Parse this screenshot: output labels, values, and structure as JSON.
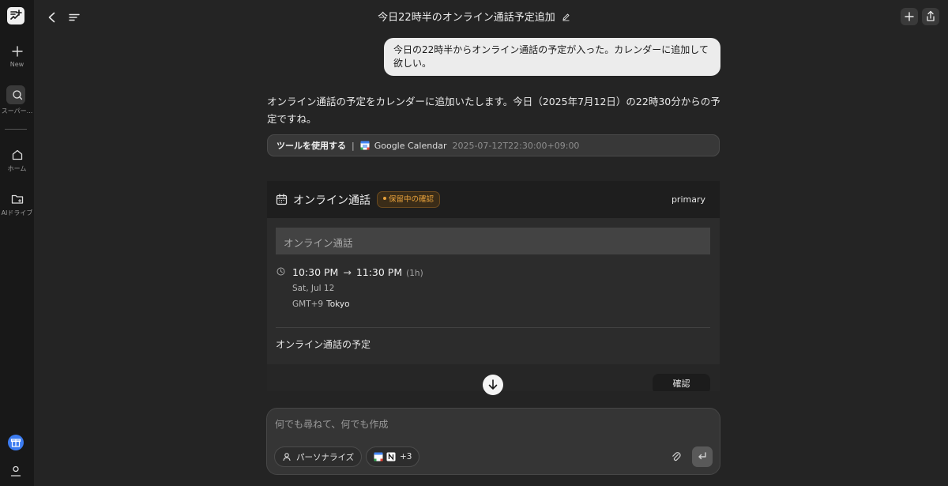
{
  "app": {
    "title": "今日22時半のオンライン通話予定追加"
  },
  "sidebar": {
    "items": [
      {
        "label": "New",
        "icon": "plus-icon"
      },
      {
        "label": "スーパー...",
        "icon": "super-agent-icon"
      },
      {
        "label": "ホーム",
        "icon": "home-icon"
      },
      {
        "label": "AIドライブ",
        "icon": "folder-icon"
      }
    ]
  },
  "conversation": {
    "user_message": "今日の22時半からオンライン通話の予定が入った。カレンダーに追加して欲しい。",
    "assistant_message": "オンライン通話の予定をカレンダーに追加いたします。今日（2025年7月12日）の22時30分からの予定ですね。",
    "tool": {
      "use_label": "ツールを使用する",
      "separator": "|",
      "service": "Google Calendar",
      "timestamp": "2025-07-12T22:30:00+09:00"
    }
  },
  "event_card": {
    "title": "オンライン通話",
    "status_badge": "保留中の確認",
    "calendar": "primary",
    "name_field": "オンライン通話",
    "start_time": "10:30 PM",
    "arrow": "→",
    "end_time": "11:30 PM",
    "duration": "(1h)",
    "date": "Sat, Jul 12",
    "timezone_offset": "GMT+9",
    "timezone_city": "Tokyo",
    "description": "オンライン通話の予定",
    "confirm_label": "確認"
  },
  "composer": {
    "placeholder": "何でも尋ねて、何でも作成",
    "personalize_label": "パーソナライズ",
    "extra_count": "+3"
  },
  "colors": {
    "background": "#242424",
    "sidebar": "#181818",
    "badge_accent": "#e9a23b",
    "gift_blue": "#3b7bf0"
  }
}
